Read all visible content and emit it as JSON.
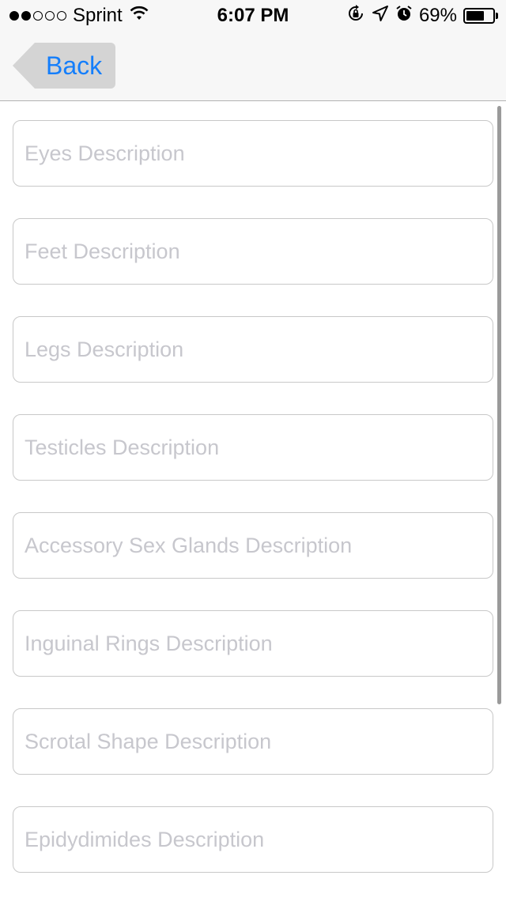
{
  "status_bar": {
    "carrier": "Sprint",
    "signal_bars_filled": 2,
    "signal_bars_total": 5,
    "time": "6:07 PM",
    "battery_percent": "69%",
    "battery_level": 0.69,
    "icons": [
      "wifi-icon",
      "orientation-lock-icon",
      "location-icon",
      "alarm-icon",
      "battery-icon"
    ]
  },
  "nav": {
    "back_label": "Back",
    "accent": "#147efb"
  },
  "fields": [
    {
      "placeholder": "Eyes Description",
      "value": ""
    },
    {
      "placeholder": "Feet Description",
      "value": ""
    },
    {
      "placeholder": "Legs Description",
      "value": ""
    },
    {
      "placeholder": "Testicles Description",
      "value": ""
    },
    {
      "placeholder": "Accessory Sex Glands Description",
      "value": ""
    },
    {
      "placeholder": "Inguinal Rings Description",
      "value": ""
    },
    {
      "placeholder": "Scrotal Shape Description",
      "value": ""
    },
    {
      "placeholder": "Epidydimides Description",
      "value": ""
    }
  ]
}
